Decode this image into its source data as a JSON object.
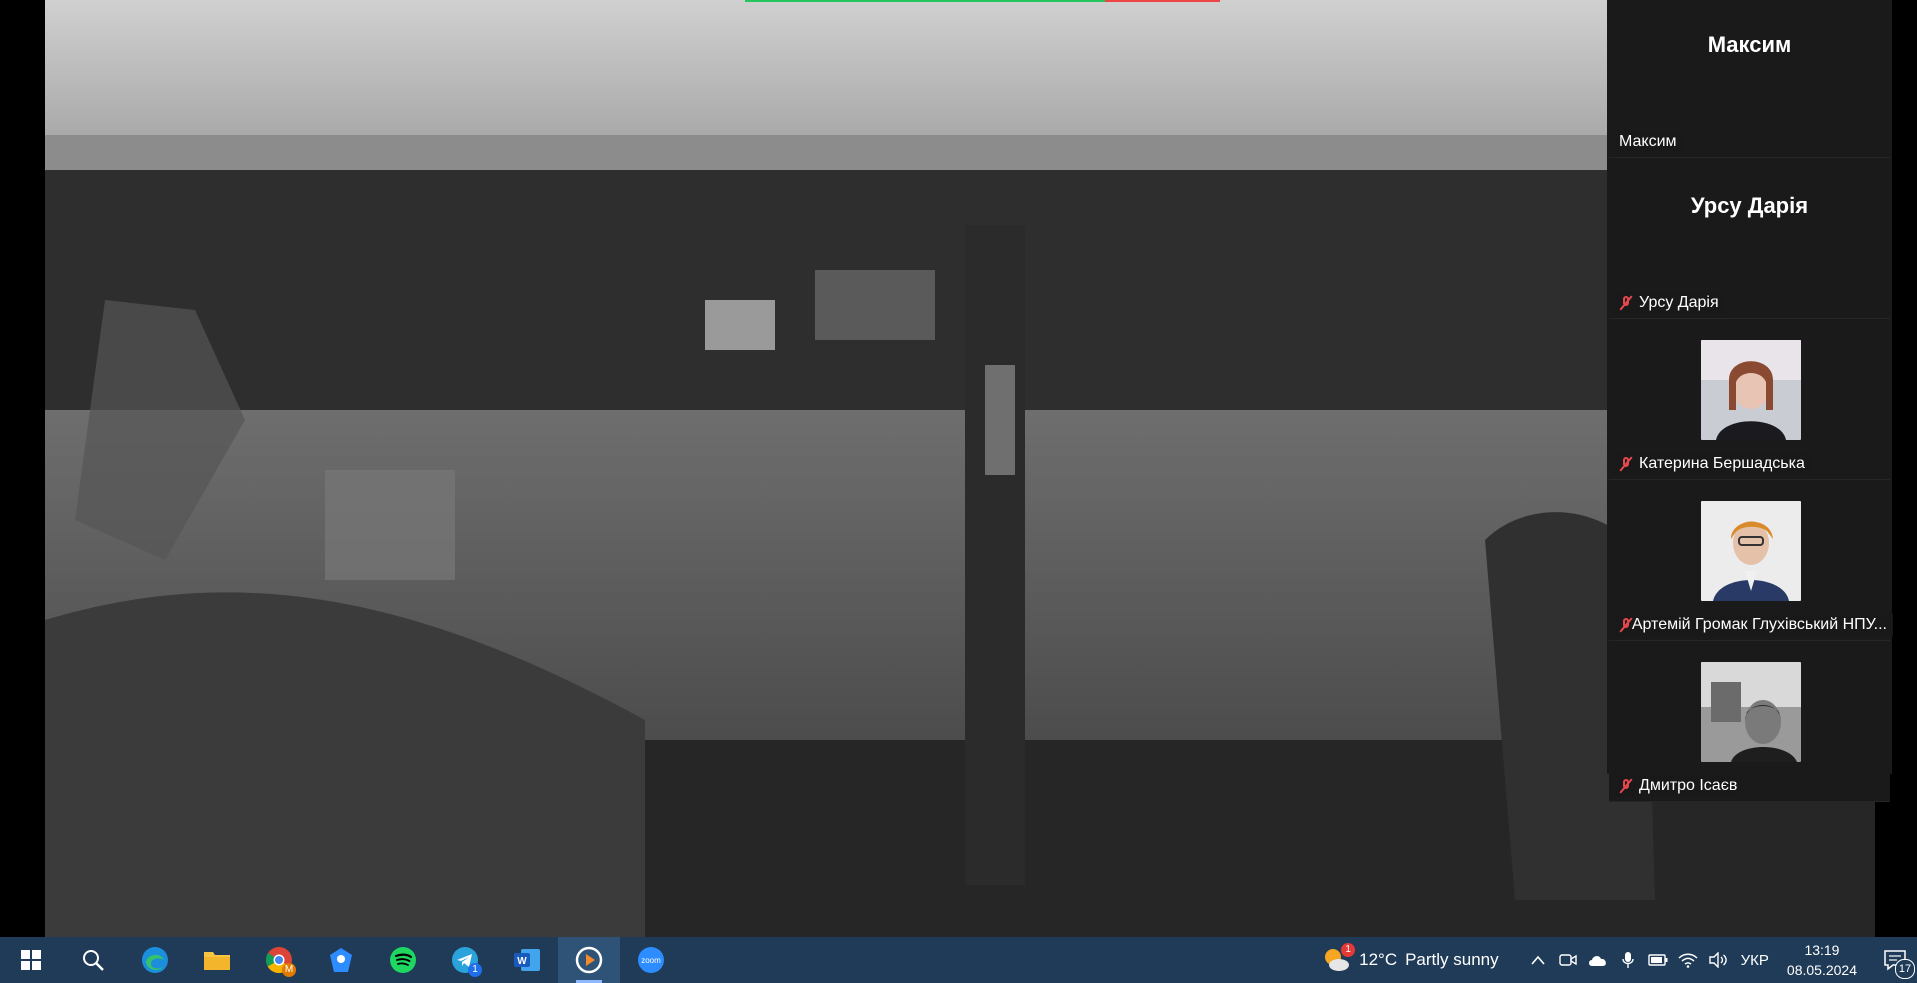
{
  "participants": [
    {
      "display_name": "Максим",
      "label": "Максим",
      "muted": false,
      "has_video": false
    },
    {
      "display_name": "Урсу Дарія",
      "label": "Урсу Дарія",
      "muted": true,
      "has_video": false
    },
    {
      "display_name": "",
      "label": "Катерина Бершадська",
      "muted": true,
      "has_video": true
    },
    {
      "display_name": "",
      "label": "Артемій Громак Глухівський НПУ...",
      "muted": true,
      "has_video": true
    },
    {
      "display_name": "",
      "label": "Дмитро Ісаєв",
      "muted": true,
      "has_video": true
    }
  ],
  "taskbar": {
    "apps": [
      {
        "name": "start-button"
      },
      {
        "name": "search-button"
      },
      {
        "name": "edge"
      },
      {
        "name": "file-explorer"
      },
      {
        "name": "chrome",
        "badge": ""
      },
      {
        "name": "app-blue"
      },
      {
        "name": "spotify"
      },
      {
        "name": "telegram",
        "badge": "1"
      },
      {
        "name": "word"
      },
      {
        "name": "media-player",
        "active": true
      },
      {
        "name": "zoom",
        "label": "zoom"
      }
    ],
    "weather": {
      "temp": "12°C",
      "desc": "Partly sunny",
      "badge": "1"
    },
    "language": "УКР",
    "time": "13:19",
    "date": "08.05.2024",
    "notifications": "17"
  },
  "colors": {
    "panel_bg": "#1a1a1a",
    "taskbar_bg": "#1f3b57",
    "mute_red": "#e5484d"
  }
}
